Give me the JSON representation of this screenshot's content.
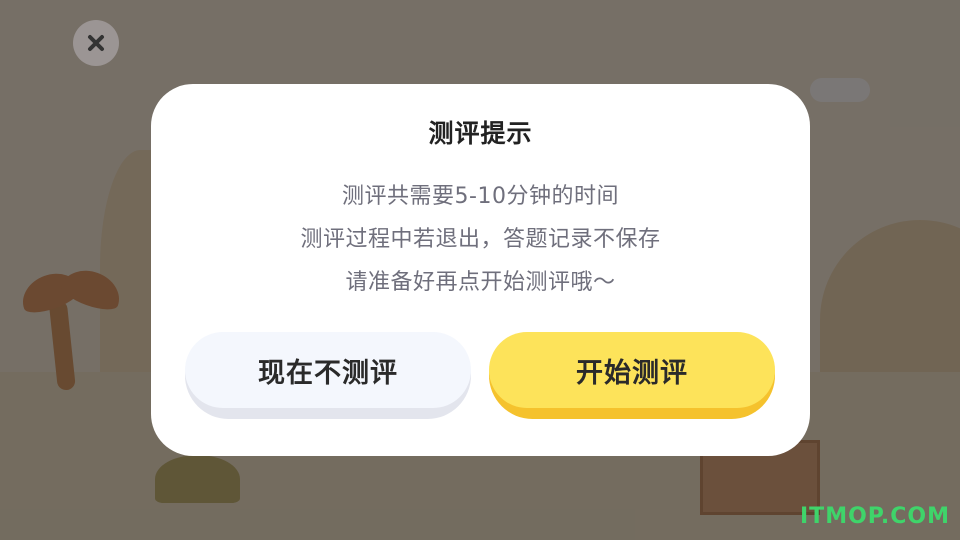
{
  "dialog": {
    "title": "测评提示",
    "lines": [
      "测评共需要5-10分钟的时间",
      "测评过程中若退出，答题记录不保存",
      "请准备好再点开始测评哦～"
    ],
    "cancel_label": "现在不测评",
    "start_label": "开始测评"
  },
  "watermark": "ITMOP.COM",
  "colors": {
    "overlay": "#282422",
    "start_button": "#fde35a",
    "cancel_button": "#f4f7fd",
    "watermark": "#3fd46a"
  },
  "icons": {
    "close": "close-icon"
  }
}
